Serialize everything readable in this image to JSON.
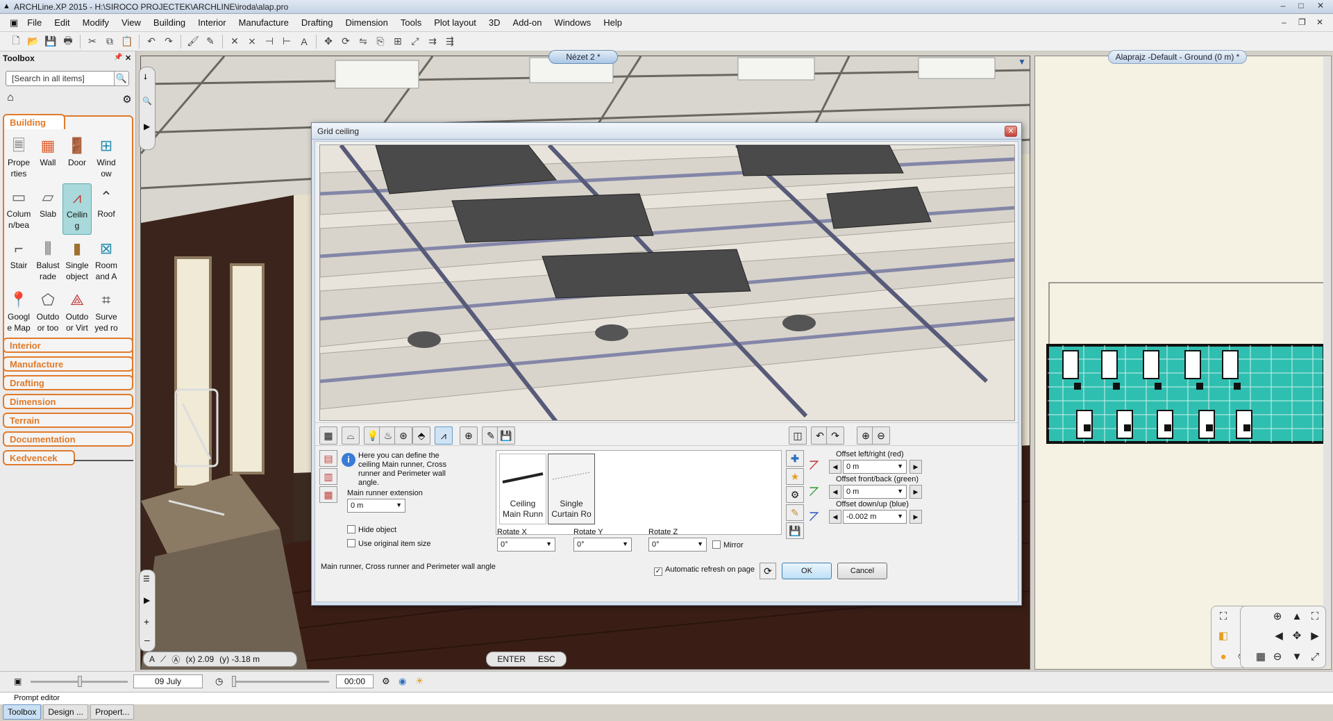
{
  "window": {
    "title": "ARCHLine.XP 2015 - H:\\SIROCO PROJECTEK\\ARCHLINE\\iroda\\alap.pro",
    "controls": [
      "–",
      "□",
      "✕"
    ]
  },
  "menu": [
    "File",
    "Edit",
    "Modify",
    "View",
    "Building",
    "Interior",
    "Manufacture",
    "Drafting",
    "Dimension",
    "Tools",
    "Plot layout",
    "3D",
    "Add-on",
    "Windows",
    "Help"
  ],
  "toolbox": {
    "title": "Toolbox",
    "pin": "📌",
    "close": "✕",
    "search_placeholder": "[Search in all items]",
    "active_category": "Building",
    "tools": [
      {
        "label": "Prope\nrties"
      },
      {
        "label": "Wall"
      },
      {
        "label": "Door"
      },
      {
        "label": "Wind\now"
      },
      {
        "label": "Colum\nn/bea"
      },
      {
        "label": "Slab"
      },
      {
        "label": "Ceilin\ng"
      },
      {
        "label": "Roof"
      },
      {
        "label": "Stair"
      },
      {
        "label": "Balust\nrade"
      },
      {
        "label": "Single\nobject"
      },
      {
        "label": "Room\nand A"
      },
      {
        "label": "Googl\ne Map"
      },
      {
        "label": "Outdo\nor too"
      },
      {
        "label": "Outdo\nor Virt"
      },
      {
        "label": "Surve\nyed ro"
      }
    ],
    "categories": [
      "Interior",
      "Manufacture",
      "Drafting",
      "Dimension",
      "Terrain",
      "Documentation",
      "Kedvencek"
    ],
    "bottom_tabs": [
      "Toolbox",
      "Design ...",
      "Propert..."
    ]
  },
  "viewport": {
    "tab": "Nézet 2 *",
    "coords_x": "(x) 2.09",
    "coords_y": "(y) -3.18 m",
    "enter": "ENTER",
    "esc": "ESC"
  },
  "plan": {
    "tab": "Alaprajz -Default - Ground (0 m) *"
  },
  "statusbar": {
    "date": "09 July",
    "time": "00:00"
  },
  "prompt": {
    "label": "Prompt editor"
  },
  "dialog": {
    "title": "Grid ceiling",
    "info": "Here you can define the ceiling Main runner, Cross runner and Perimeter wall angle.",
    "main_runner_label": "Main runner extension",
    "main_runner_value": "0 m",
    "hide_object": "Hide object",
    "use_original": "Use original item size",
    "items": [
      {
        "label": "Ceiling\nMain Runn",
        "selected": false
      },
      {
        "label": "Single\nCurtain Ro",
        "selected": true
      }
    ],
    "offset_lr_label": "Offset left/right (red)",
    "offset_lr_value": "0 m",
    "offset_fb_label": "Offset front/back (green)",
    "offset_fb_value": "0 m",
    "offset_ud_label": "Offset down/up (blue)",
    "offset_ud_value": "-0.002 m",
    "rotate_x_label": "Rotate X",
    "rotate_x_value": "0°",
    "rotate_y_label": "Rotate Y",
    "rotate_y_value": "0°",
    "rotate_z_label": "Rotate Z",
    "rotate_z_value": "0°",
    "mirror": "Mirror",
    "status": "Main runner, Cross runner and Perimeter wall angle",
    "auto_refresh": "Automatic refresh on page",
    "auto_refresh_checked": true,
    "ok": "OK",
    "cancel": "Cancel"
  },
  "colors": {
    "accent": "#e07a2a",
    "selection": "#a9d9db",
    "plan_floor": "#2fbfb0",
    "dialog_frame": "#d9e2ee"
  }
}
